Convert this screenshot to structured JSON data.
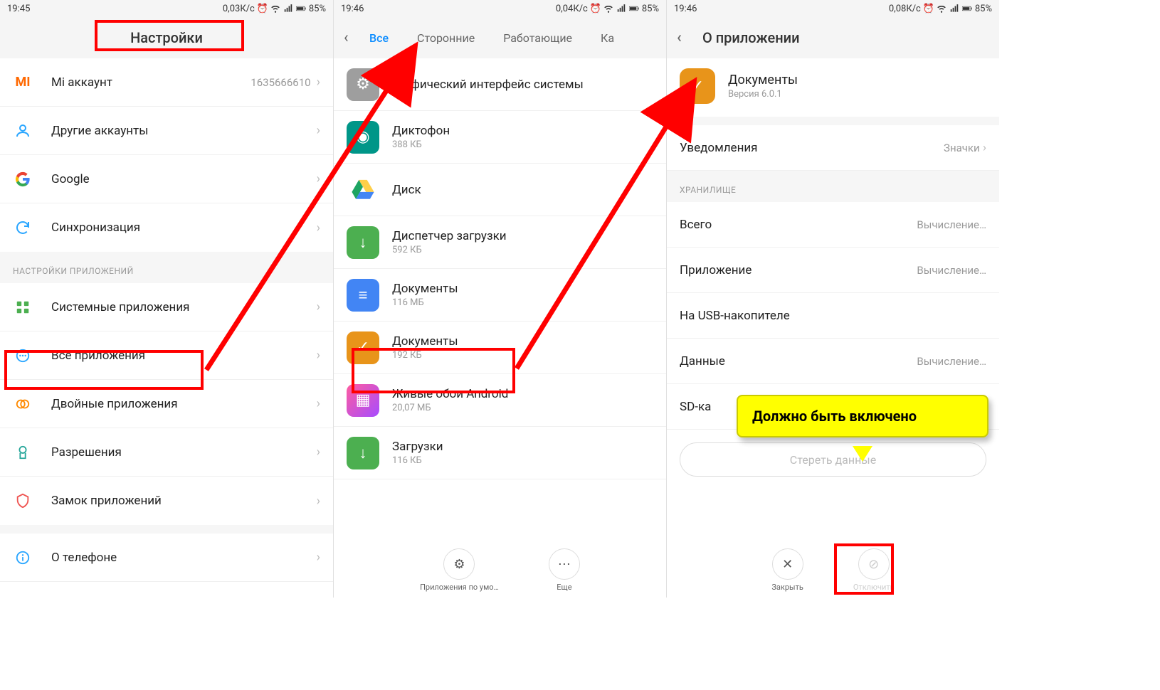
{
  "callout_text": "Должно быть включено",
  "screen1": {
    "status": {
      "time": "19:45",
      "speed": "0,03К/с",
      "battery": "85%"
    },
    "title": "Настройки",
    "rows_top": [
      {
        "icon": "mi",
        "label": "Mi аккаунт",
        "value": "1635666610"
      },
      {
        "icon": "person",
        "label": "Другие аккаунты",
        "value": ""
      },
      {
        "icon": "google",
        "label": "Google",
        "value": ""
      },
      {
        "icon": "sync",
        "label": "Синхронизация",
        "value": ""
      }
    ],
    "section_label": "НАСТРОЙКИ ПРИЛОЖЕНИЙ",
    "rows_apps": [
      {
        "icon": "grid",
        "label": "Системные приложения"
      },
      {
        "icon": "dots",
        "label": "Все приложения"
      },
      {
        "icon": "dual",
        "label": "Двойные приложения"
      },
      {
        "icon": "perm",
        "label": "Разрешения"
      },
      {
        "icon": "lock",
        "label": "Замок приложений"
      }
    ],
    "rows_bottom": [
      {
        "icon": "info",
        "label": "О телефоне"
      }
    ]
  },
  "screen2": {
    "status": {
      "time": "19:46",
      "speed": "0,04К/с",
      "battery": "85%"
    },
    "tabs": [
      "Все",
      "Сторонние",
      "Работающие",
      "Ка"
    ],
    "active_tab": 0,
    "apps": [
      {
        "name": "Графический интерфейс системы",
        "size": "",
        "color": "bg-gray",
        "glyph": "⚙"
      },
      {
        "name": "Диктофон",
        "size": "388 КБ",
        "color": "bg-teal",
        "glyph": "◉"
      },
      {
        "name": "Диск",
        "size": "",
        "color": "",
        "glyph": "drive"
      },
      {
        "name": "Диспетчер загрузки",
        "size": "592 КБ",
        "color": "bg-green",
        "glyph": "↓"
      },
      {
        "name": "Документы",
        "size": "116 МБ",
        "color": "bg-blue",
        "glyph": "≡"
      },
      {
        "name": "Документы",
        "size": "192 КБ",
        "color": "bg-orange",
        "glyph": "✓"
      },
      {
        "name": "Живые обои Android",
        "size": "20,07 МБ",
        "color": "bg-purple",
        "glyph": "▦"
      },
      {
        "name": "Загрузки",
        "size": "116 КБ",
        "color": "bg-green",
        "glyph": "↓"
      }
    ],
    "bottom": [
      {
        "glyph": "⚙",
        "label": "Приложения по умо…"
      },
      {
        "glyph": "⋯",
        "label": "Еще"
      }
    ]
  },
  "screen3": {
    "status": {
      "time": "19:46",
      "speed": "0,08К/с",
      "battery": "85%"
    },
    "title": "О приложении",
    "app": {
      "name": "Документы",
      "version": "Версия 6.0.1"
    },
    "notif_row": {
      "label": "Уведомления",
      "value": "Значки"
    },
    "storage_label": "ХРАНИЛИЩЕ",
    "storage": [
      {
        "label": "Всего",
        "value": "Вычисление…"
      },
      {
        "label": "Приложение",
        "value": "Вычисление…"
      },
      {
        "label": "На USB-накопителе",
        "value": ""
      },
      {
        "label": "Данные",
        "value": "Вычисление…"
      },
      {
        "label": "SD-ка",
        "value": ""
      }
    ],
    "erase_label": "Стереть данные",
    "bottom": [
      {
        "glyph": "✕",
        "label": "Закрыть"
      },
      {
        "glyph": "⊘",
        "label": "Отключить"
      }
    ]
  }
}
